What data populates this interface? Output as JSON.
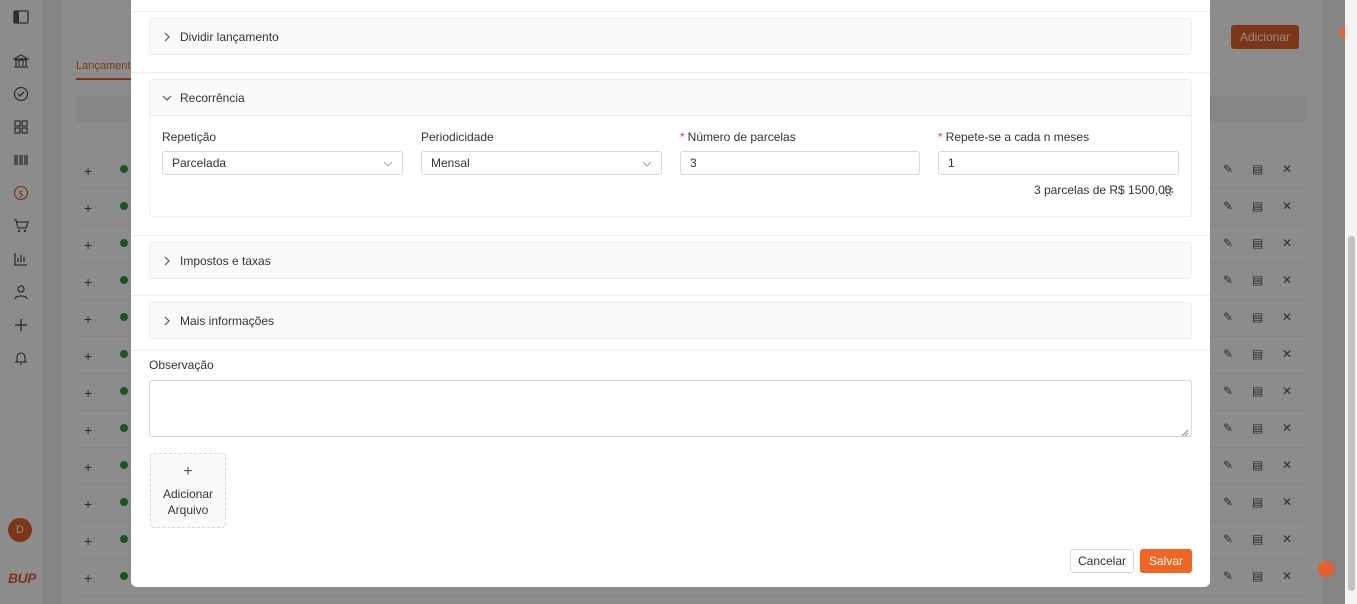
{
  "sidebar": {
    "icons": [
      "panel-toggle-icon",
      "bank-icon",
      "check-circle-icon",
      "grid-icon",
      "barcode-icon",
      "dollar-circle-icon",
      "cart-icon",
      "chart-icon",
      "user-icon",
      "plus-icon",
      "bell-icon"
    ],
    "avatar_initial": "D",
    "logo_text": "BUP"
  },
  "background": {
    "tab_label": "Lançamentos",
    "add_button_label": "Adicionar",
    "row_plus": "+",
    "status_color": "#2e9e3e"
  },
  "modal": {
    "split_section": {
      "title": "Dividir lançamento"
    },
    "recurrence_section": {
      "title": "Recorrência",
      "repetition": {
        "label": "Repetição",
        "value": "Parcelada"
      },
      "periodicity": {
        "label": "Periodicidade",
        "value": "Mensal"
      },
      "installments": {
        "label": "Número de parcelas",
        "required_mark": "*",
        "value": "3"
      },
      "every_n_months": {
        "label": "Repete-se a cada n meses",
        "required_mark": "*",
        "value": "1"
      },
      "summary": "3 parcelas de R$ 1500,00"
    },
    "taxes_section": {
      "title": "Impostos e taxas"
    },
    "more_info_section": {
      "title": "Mais informações"
    },
    "observation": {
      "label": "Observação",
      "value": ""
    },
    "upload": {
      "plus": "+",
      "line1": "Adicionar",
      "line2": "Arquivo"
    },
    "buttons": {
      "cancel": "Cancelar",
      "save": "Salvar"
    }
  },
  "colors": {
    "accent": "#f26522",
    "required": "#e8412c"
  }
}
